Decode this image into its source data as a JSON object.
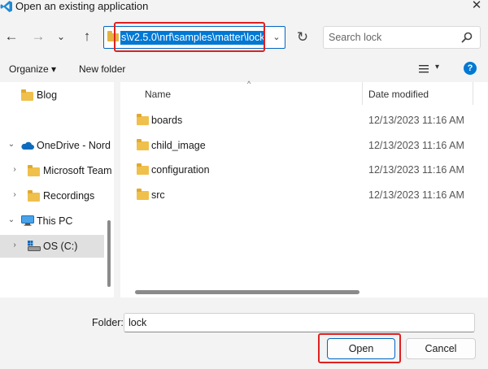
{
  "window": {
    "title": "Open an existing application",
    "close_symbol": "✕",
    "app_icon": "vscode-icon"
  },
  "address_bar": {
    "back_symbol": "←",
    "forward_symbol": "→",
    "recent_symbol": "⌄",
    "up_symbol": "↑",
    "path": "s\\v2.5.0\\nrf\\samples\\matter\\lock",
    "dropdown_symbol": "⌄",
    "refresh_symbol": "↻",
    "search_placeholder": "Search lock"
  },
  "toolbar": {
    "organize_label": "Organize ▾",
    "new_folder_label": "New folder",
    "view_dropdown_symbol": "▾",
    "help_label": "?"
  },
  "nav_pane": {
    "items": [
      {
        "label": "Blog",
        "chevron": "",
        "icon": "folder-icon"
      },
      {
        "label": "OneDrive - Nord",
        "chevron": "⌄",
        "icon": "cloud-icon"
      },
      {
        "label": "Microsoft Team",
        "chevron": "›",
        "icon": "folder-icon"
      },
      {
        "label": "Recordings",
        "chevron": "›",
        "icon": "folder-icon"
      },
      {
        "label": "This PC",
        "chevron": "⌄",
        "icon": "monitor-icon"
      },
      {
        "label": "OS (C:)",
        "chevron": "›",
        "icon": "drive-icon",
        "selected": true
      }
    ]
  },
  "file_list": {
    "columns": {
      "name": "Name",
      "date": "Date modified"
    },
    "sort_caret": "^",
    "rows": [
      {
        "name": "boards",
        "date": "12/13/2023 11:16 AM"
      },
      {
        "name": "child_image",
        "date": "12/13/2023 11:16 AM"
      },
      {
        "name": "configuration",
        "date": "12/13/2023 11:16 AM"
      },
      {
        "name": "src",
        "date": "12/13/2023 11:16 AM"
      }
    ]
  },
  "footer": {
    "folder_label": "Folder:",
    "folder_value": "lock",
    "open_label": "Open",
    "cancel_label": "Cancel"
  },
  "colors": {
    "accent": "#0078d4",
    "highlight_box": "#e02020",
    "folder": "#f0c04c"
  }
}
